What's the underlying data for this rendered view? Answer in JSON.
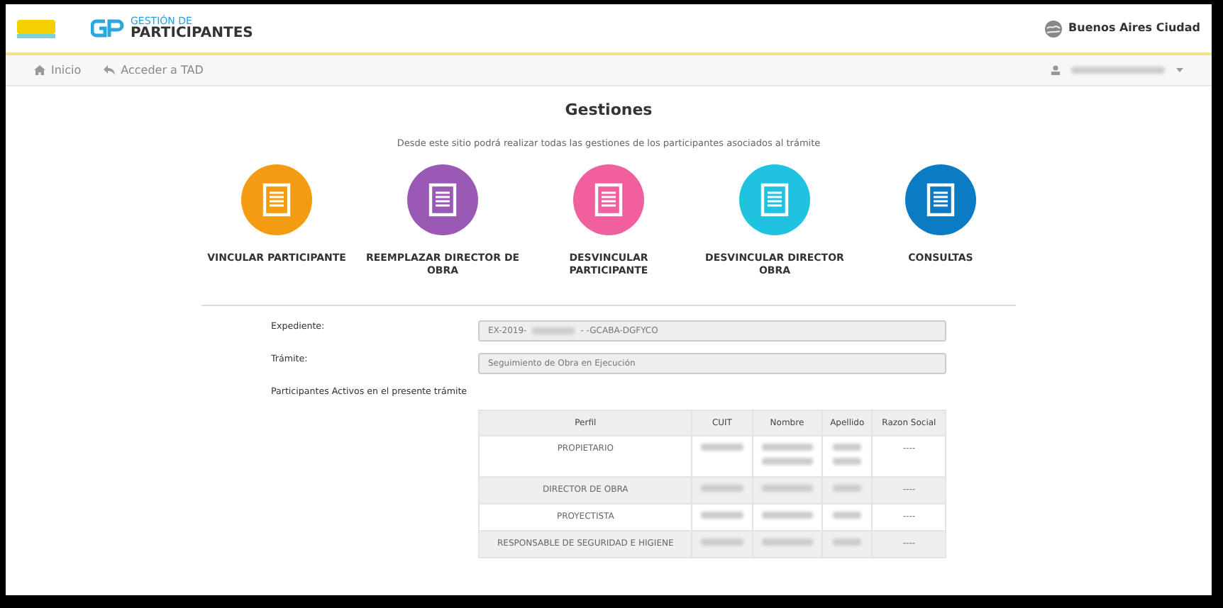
{
  "header": {
    "logo_small_text": "GESTIÓN DE",
    "logo_big_text": "PARTICIPANTES",
    "city_name": "Buenos Aires Ciudad"
  },
  "nav": {
    "items": [
      {
        "label": "Inicio",
        "kind": "home"
      },
      {
        "label": "Acceder a TAD",
        "kind": "reply"
      }
    ]
  },
  "title": "Gestiones",
  "subtitle": "Desde este sitio podrá realizar todas las gestiones de los participantes asociados al trámite",
  "actions": [
    {
      "label": "VINCULAR PARTICIPANTE",
      "color": "#f39c12"
    },
    {
      "label": "REEMPLAZAR DIRECTOR DE OBRA",
      "color": "#9b59b6"
    },
    {
      "label": "DESVINCULAR PARTICIPANTE",
      "color": "#f0609e"
    },
    {
      "label": "DESVINCULAR DIRECTOR OBRA",
      "color": "#1fc3e0"
    },
    {
      "label": "CONSULTAS",
      "color": "#0b7cc4"
    }
  ],
  "form": {
    "expediente": {
      "label": "Expediente:",
      "value_prefix": "EX-2019-",
      "value_suffix": "- -GCABA-DGFYCO"
    },
    "tramite": {
      "label": "Trámite:",
      "value": "Seguimiento de Obra en Ejecución"
    },
    "participants_label": "Participantes Activos en el presente trámite"
  },
  "table": {
    "columns": [
      "Perfil",
      "CUIT",
      "Nombre",
      "Apellido",
      "Razon Social"
    ],
    "rows": [
      [
        {
          "kind": "text",
          "text": "PROPIETARIO"
        },
        {
          "kind": "redacted"
        },
        {
          "kind": "redacted2"
        },
        {
          "kind": "redacted2"
        },
        {
          "kind": "text",
          "text": "----"
        }
      ],
      [
        {
          "kind": "text",
          "text": "DIRECTOR DE OBRA"
        },
        {
          "kind": "redacted"
        },
        {
          "kind": "redacted"
        },
        {
          "kind": "redacted"
        },
        {
          "kind": "text",
          "text": "----"
        }
      ],
      [
        {
          "kind": "text",
          "text": "PROYECTISTA"
        },
        {
          "kind": "redacted"
        },
        {
          "kind": "redacted"
        },
        {
          "kind": "redacted"
        },
        {
          "kind": "text",
          "text": "----"
        }
      ],
      [
        {
          "kind": "text",
          "text": "RESPONSABLE DE SEGURIDAD E HIGIENE"
        },
        {
          "kind": "redacted"
        },
        {
          "kind": "redacted"
        },
        {
          "kind": "redacted"
        },
        {
          "kind": "text",
          "text": "----"
        }
      ]
    ]
  }
}
